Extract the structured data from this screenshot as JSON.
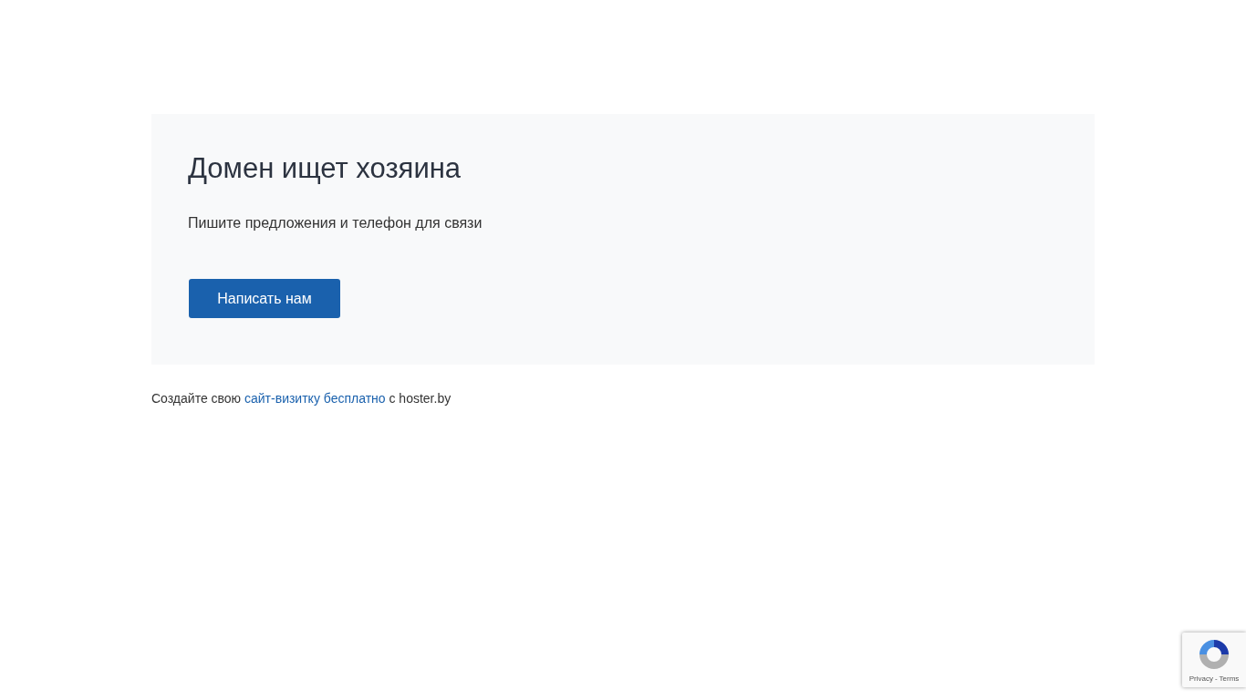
{
  "card": {
    "title": "Домен ищет хозяина",
    "text": "Пишите предложения и телефон для связи",
    "button": "Написать нам"
  },
  "footer": {
    "before": "Создайте свою",
    "link": "сайт-визитку бесплатно",
    "after": "с hoster.by"
  },
  "recaptcha_badge": {
    "privacy": "Privacy",
    "separator": "-",
    "terms": "Terms"
  }
}
